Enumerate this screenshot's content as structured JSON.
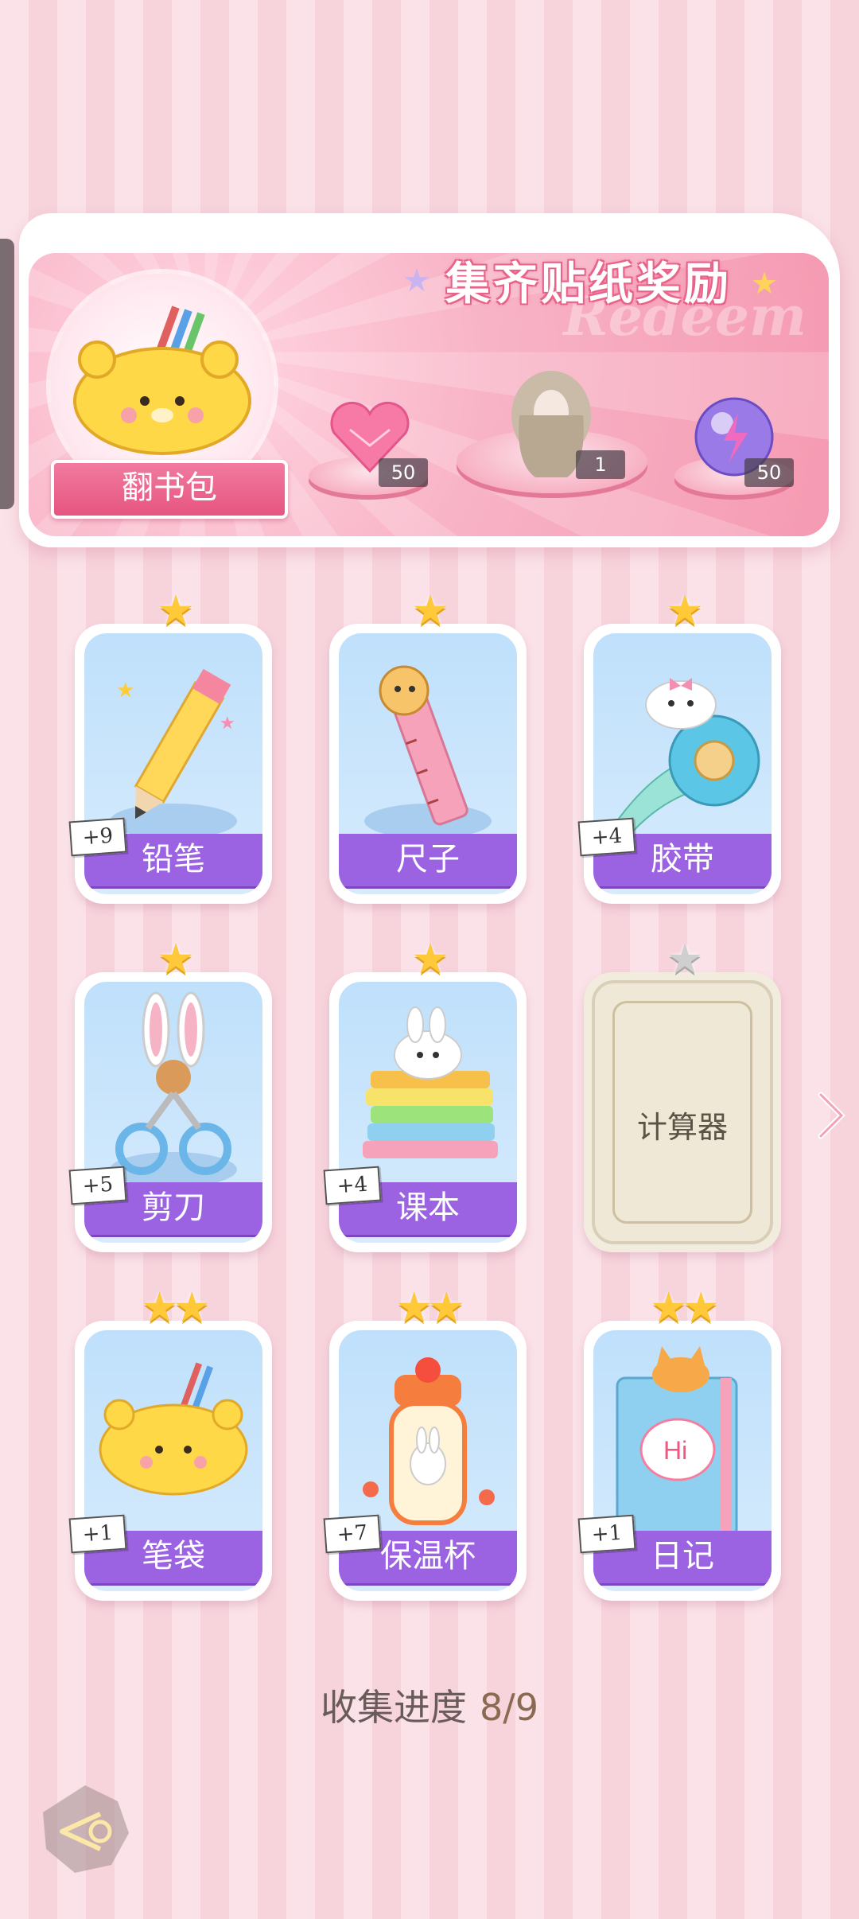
{
  "banner": {
    "title": "集齐贴纸奖励",
    "watermark": "Redeem",
    "collection_name": "翻书包",
    "rewards": [
      {
        "icon": "pink-heart-gem-icon",
        "count": "50"
      },
      {
        "icon": "outfit-avatar-icon",
        "count": "1"
      },
      {
        "icon": "energy-orb-icon",
        "count": "50"
      }
    ]
  },
  "cards": [
    {
      "name": "铅笔",
      "stars": "★",
      "count": "+9",
      "icon": "pencil-icon",
      "collected": true
    },
    {
      "name": "尺子",
      "stars": "★",
      "count": "",
      "icon": "ruler-icon",
      "collected": true
    },
    {
      "name": "胶带",
      "stars": "★",
      "count": "+4",
      "icon": "tape-icon",
      "collected": true
    },
    {
      "name": "剪刀",
      "stars": "★",
      "count": "+5",
      "icon": "scissors-icon",
      "collected": true
    },
    {
      "name": "课本",
      "stars": "★",
      "count": "+4",
      "icon": "books-icon",
      "collected": true
    },
    {
      "name": "计算器",
      "stars": "★",
      "count": "",
      "icon": "calculator-locked-icon",
      "collected": false
    },
    {
      "name": "笔袋",
      "stars": "★★",
      "count": "+1",
      "icon": "pencil-case-icon",
      "collected": true
    },
    {
      "name": "保温杯",
      "stars": "★★",
      "count": "+7",
      "icon": "thermos-icon",
      "collected": true
    },
    {
      "name": "日记",
      "stars": "★★",
      "count": "+1",
      "icon": "diary-icon",
      "collected": true
    }
  ],
  "progress": {
    "label": "收集进度",
    "value": "8/9",
    "fraction": 0.889
  },
  "colors": {
    "label_purple": "#9b62e1",
    "banner_pink": "#f59ab2",
    "star_gold": "#ffc93a"
  }
}
